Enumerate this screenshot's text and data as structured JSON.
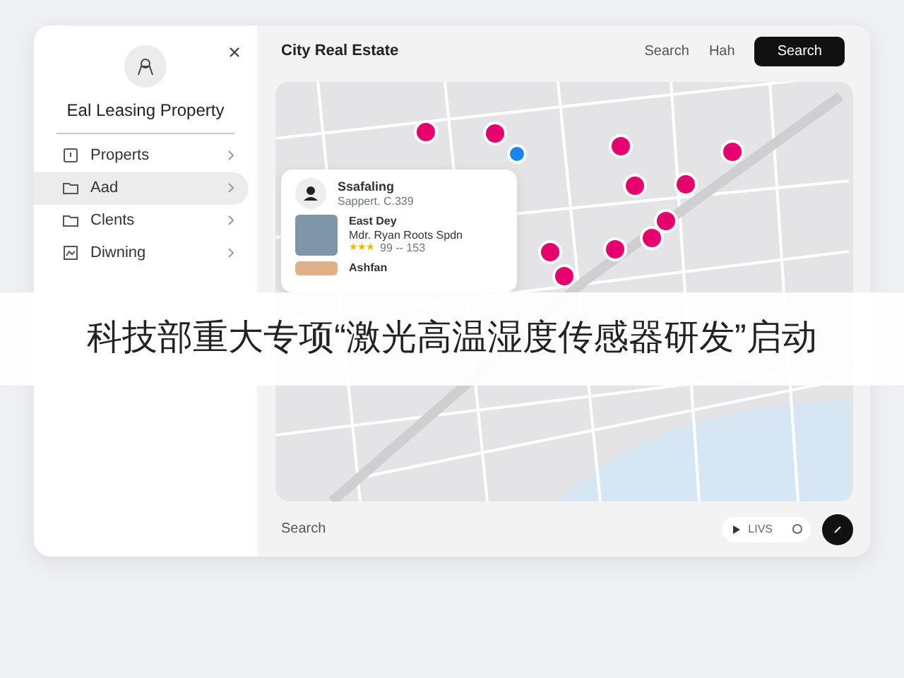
{
  "sidebar": {
    "title": "Eal Leasing Property",
    "items": [
      {
        "label": "Properts",
        "selected": false
      },
      {
        "label": "Aad",
        "selected": true
      },
      {
        "label": "Clents",
        "selected": false
      },
      {
        "label": "Diwning",
        "selected": false
      }
    ]
  },
  "header": {
    "title": "City Real Estate",
    "links": [
      "Search",
      "Hah"
    ],
    "button": "Search"
  },
  "map_card": {
    "title": "Ssafaling",
    "subtitle": "Sappert. C.339",
    "listings": [
      {
        "title": "East Dey",
        "subtitle": "Mdr. Ryan Roots Spdn",
        "stars": 3,
        "meta": "99 -- 153"
      },
      {
        "title": "Ashfan"
      }
    ]
  },
  "footer": {
    "search_placeholder": "Search",
    "toggle_label": "LIVS"
  },
  "banner": {
    "headline": "科技部重大专项“激光高温湿度传感器研发”启动"
  }
}
